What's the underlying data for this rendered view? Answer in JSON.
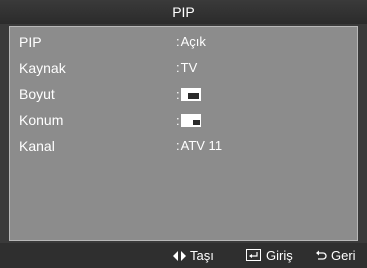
{
  "header": {
    "title": "PIP"
  },
  "menu": {
    "items": [
      {
        "label": "PIP",
        "value": "Açık"
      },
      {
        "label": "Kaynak",
        "value": "TV"
      },
      {
        "label": "Boyut",
        "value": ""
      },
      {
        "label": "Konum",
        "value": ""
      },
      {
        "label": "Kanal",
        "value": "ATV 11"
      }
    ],
    "separator": ":"
  },
  "footer": {
    "move_label": "Taşı",
    "enter_label": "Giriş",
    "back_label": "Geri"
  },
  "colors": {
    "osd_background": "#3a3a3a",
    "panel_background": "#8c8c8c",
    "text": "#ffffff"
  }
}
